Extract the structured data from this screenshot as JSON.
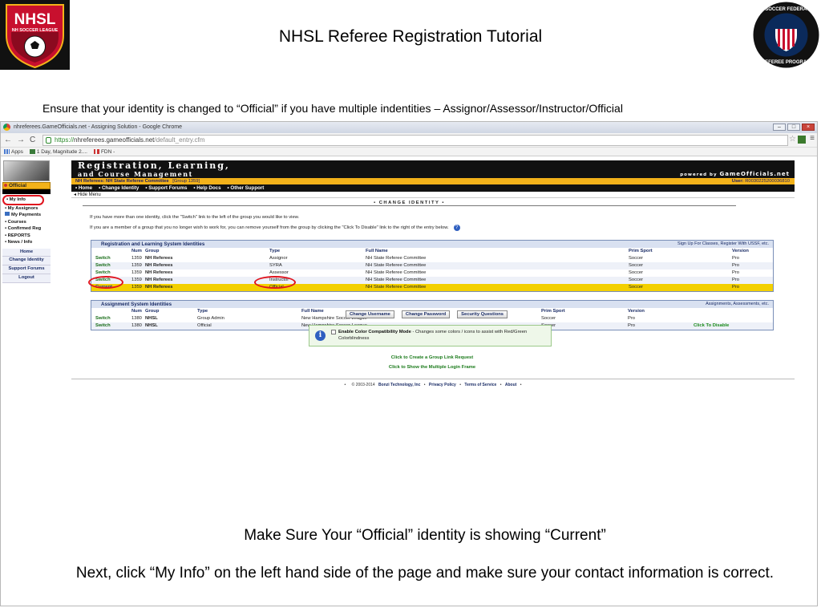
{
  "slide": {
    "title": "NHSL Referee Registration Tutorial",
    "subtitle": "Ensure that your identity is changed to “Official” if you have multiple indentities – Assignor/Assessor/Instructor/Official",
    "caption_1": "Make Sure Your “Official” identity is showing “Current”",
    "caption_2": "Next, click “My Info” on the left hand side of the page and make sure your contact information is correct.",
    "logo_left_text": "NHSL",
    "logo_left_sub": "NH SOCCER LEAGUE",
    "logo_right_text": "U.S. SOCCER FEDERATION",
    "logo_right_sub": "REFEREE PROGRAM"
  },
  "browser": {
    "window_title": "nhreferees.GameOfficials.net - Assigning Solution - Google Chrome",
    "url_scheme": "https://",
    "url_host": "nhreferees.gameofficials.net",
    "url_path": "/default_entry.cfm",
    "back_glyph": "←",
    "forward_glyph": "→",
    "reload_glyph": "C",
    "star_glyph": "☆",
    "menu_glyph": "≡",
    "bookmarks": [
      "Apps",
      "1 Day, Magnitude 2....",
      "FDN -"
    ]
  },
  "app": {
    "header_line1": "Registration, Learning,",
    "header_line2": "and Course Management",
    "powered_prefix": "powered by",
    "powered_brand": "GameOfficials.net",
    "org_name": "NH Referees: NH State Referee Committee",
    "org_group": "[Group 1359]",
    "user_label": "User:",
    "user_id": "R0030225200036810",
    "top_nav": [
      "• Home",
      "• Change Identity",
      "• Support Forums",
      "• Help Docs",
      "• Other Support"
    ],
    "hide_menu": "◂ Hide Menu",
    "role": "Official",
    "side_menu": [
      "▪ My Info",
      "▪ My Assignors",
      "My Payments",
      "▪ Courses",
      "▪ Confirmed Reg",
      "▪ REPORTS",
      "▪ News / Info"
    ],
    "side_links": [
      "Home",
      "Change Identity",
      "Support Forums",
      "Logout"
    ],
    "section_title": "• CHANGE IDENTITY •",
    "instruction_1": "If you have more than one identity, click the \"Switch\" link to the left of the group you would like to view.",
    "instruction_2": "If you are a member of a group that you no longer wish to work for, you can remove yourself from the group by clicking the \"Click To Disable\" link to the right of the entry below.",
    "help_glyph": "?"
  },
  "registration_table": {
    "title": "Registration and Learning System Identities",
    "right_link": "Sign Up For Classes, Register With USSF, etc.",
    "headers": [
      "Num",
      "Group",
      "Type",
      "Full Name",
      "Prim Sport",
      "Version"
    ],
    "rows": [
      {
        "action": "Switch",
        "num": "1359",
        "group": "NH Referees",
        "type": "Assignor",
        "full_name": "NH State Referee Committee",
        "sport": "Soccer",
        "version": "Pro"
      },
      {
        "action": "Switch",
        "num": "1359",
        "group": "NH Referees",
        "type": "SYRA",
        "full_name": "NH State Referee Committee",
        "sport": "Soccer",
        "version": "Pro"
      },
      {
        "action": "Switch",
        "num": "1359",
        "group": "NH Referees",
        "type": "Assessor",
        "full_name": "NH State Referee Committee",
        "sport": "Soccer",
        "version": "Pro"
      },
      {
        "action": "Switch",
        "num": "1359",
        "group": "NH Referees",
        "type": "Instructor",
        "full_name": "NH State Referee Committee",
        "sport": "Soccer",
        "version": "Pro"
      },
      {
        "action": "Current",
        "num": "1359",
        "group": "NH Referees",
        "type": "Official",
        "full_name": "NH State Referee Committee",
        "sport": "Soccer",
        "version": "Pro"
      }
    ]
  },
  "assignment_table": {
    "title": "Assignment System Identities",
    "right_link": "Assignments, Assessments, etc.",
    "headers": [
      "Num",
      "Group",
      "Type",
      "Full Name",
      "Prim Sport",
      "Version"
    ],
    "rows": [
      {
        "action": "Switch",
        "num": "1380",
        "group": "NHSL",
        "type": "Group Admin",
        "full_name": "New Hampshire Soccer League",
        "sport": "Soccer",
        "version": "Pro",
        "extra": ""
      },
      {
        "action": "Switch",
        "num": "1380",
        "group": "NHSL",
        "type": "Official",
        "full_name": "New Hampshire Soccer League",
        "sport": "Soccer",
        "version": "Pro",
        "extra": "Click To Disable"
      }
    ]
  },
  "buttons": {
    "change_username": "Change Username",
    "change_password": "Change Password",
    "security_questions": "Security Questions"
  },
  "color_mode": {
    "label": "Enable Color Compatibility Mode",
    "description": " - Changes some colors / icons to assist with Red/Green Colorblindness",
    "info_glyph": "i"
  },
  "links": {
    "group_link": "Click to Create a Group Link Request",
    "multiple_login": "Click to Show the Multiple Login Frame"
  },
  "footer": {
    "copyright": "© 2003-2014",
    "company": "Bonzi Technology, Inc",
    "privacy": "Privacy Policy",
    "terms": "Terms of Service",
    "about": "About",
    "bullet": "•"
  },
  "colors": {
    "accent_gold": "#f3b21a",
    "highlight_yellow": "#f3d000",
    "annotation_red": "#e0141e",
    "switch_green": "#1a6e1a"
  }
}
